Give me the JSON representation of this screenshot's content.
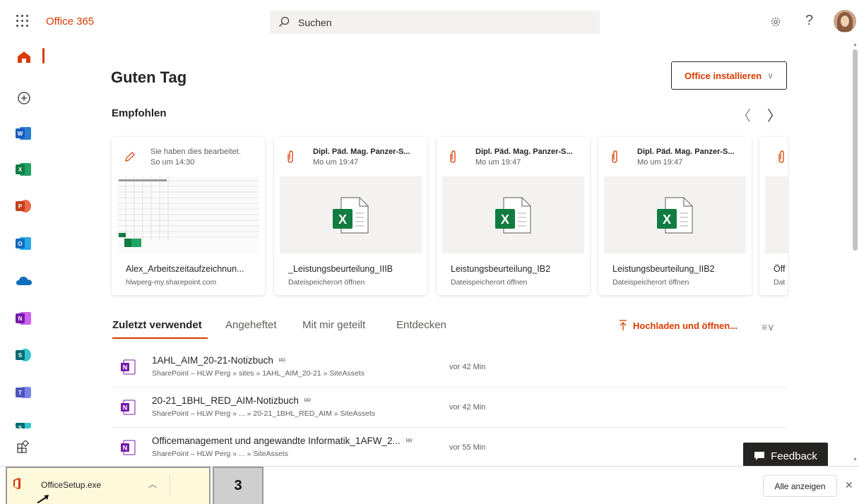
{
  "topbar": {
    "app_title": "Office 365",
    "search_placeholder": "Suchen"
  },
  "main": {
    "greeting": "Guten Tag",
    "install_label": "Office installieren",
    "recommended_title": "Empfohlen"
  },
  "recommended": [
    {
      "title": "Sie haben dies bearbeitet.",
      "subtitle": "So um 14:30",
      "name": "Alex_Arbeitszeitaufzeichnun...",
      "location": "hlwperg-my.sharepoint.com",
      "icon": "pencil-icon"
    },
    {
      "title": "Dipl. Päd. Mag. Panzer-S...",
      "subtitle": "Mo um 19:47",
      "name": "_Leistungsbeurteilung_IIIB",
      "location": "Dateispeicherort öffnen",
      "icon": "paperclip-icon"
    },
    {
      "title": "Dipl. Päd. Mag. Panzer-S...",
      "subtitle": "Mo um 19:47",
      "name": "Leistungsbeurteilung_IB2",
      "location": "Dateispeicherort öffnen",
      "icon": "paperclip-icon"
    },
    {
      "title": "Dipl. Päd. Mag. Panzer-S...",
      "subtitle": "Mo um 19:47",
      "name": "Leistungsbeurteilung_IIB2",
      "location": "Dateispeicherort öffnen",
      "icon": "paperclip-icon"
    },
    {
      "title": "",
      "subtitle": "",
      "name": "Öff",
      "location": "Dat",
      "icon": "paperclip-icon"
    }
  ],
  "tabs": [
    {
      "label": "Zuletzt verwendet"
    },
    {
      "label": "Angeheftet"
    },
    {
      "label": "Mit mir geteilt"
    },
    {
      "label": "Entdecken"
    }
  ],
  "upload_label": "Hochladen und öffnen...",
  "files": [
    {
      "name": "1AHL_AIM_20-21-Notizbuch",
      "path": "SharePoint – HLW Perg » sites » 1AHL_AIM_20-21 » SiteAssets",
      "time": "vor 42 Min"
    },
    {
      "name": "20-21_1BHL_RED_AIM-Notizbuch",
      "path": "SharePoint – HLW Perg » ... » 20-21_1BHL_RED_AIM » SiteAssets",
      "time": "vor 42 Min"
    },
    {
      "name": "Officemanagement und angewandte Informatik_1AFW_2...",
      "path": "SharePoint – HLW Perg » ... » SiteAssets",
      "time": "vor 55 Min"
    }
  ],
  "feedback_label": "Feedback",
  "download_bar": {
    "file_name": "OfficeSetup.exe",
    "step_number": "3",
    "show_all_label": "Alle anzeigen"
  },
  "colors": {
    "accent": "#d83b01",
    "word": "#185abd",
    "excel": "#107c41",
    "powerpoint": "#c43e1c",
    "outlook": "#0f6cbd",
    "onedrive": "#0f6cbd",
    "onenote": "#7719aa",
    "sharepoint": "#036c70",
    "teams": "#4b53bc"
  }
}
